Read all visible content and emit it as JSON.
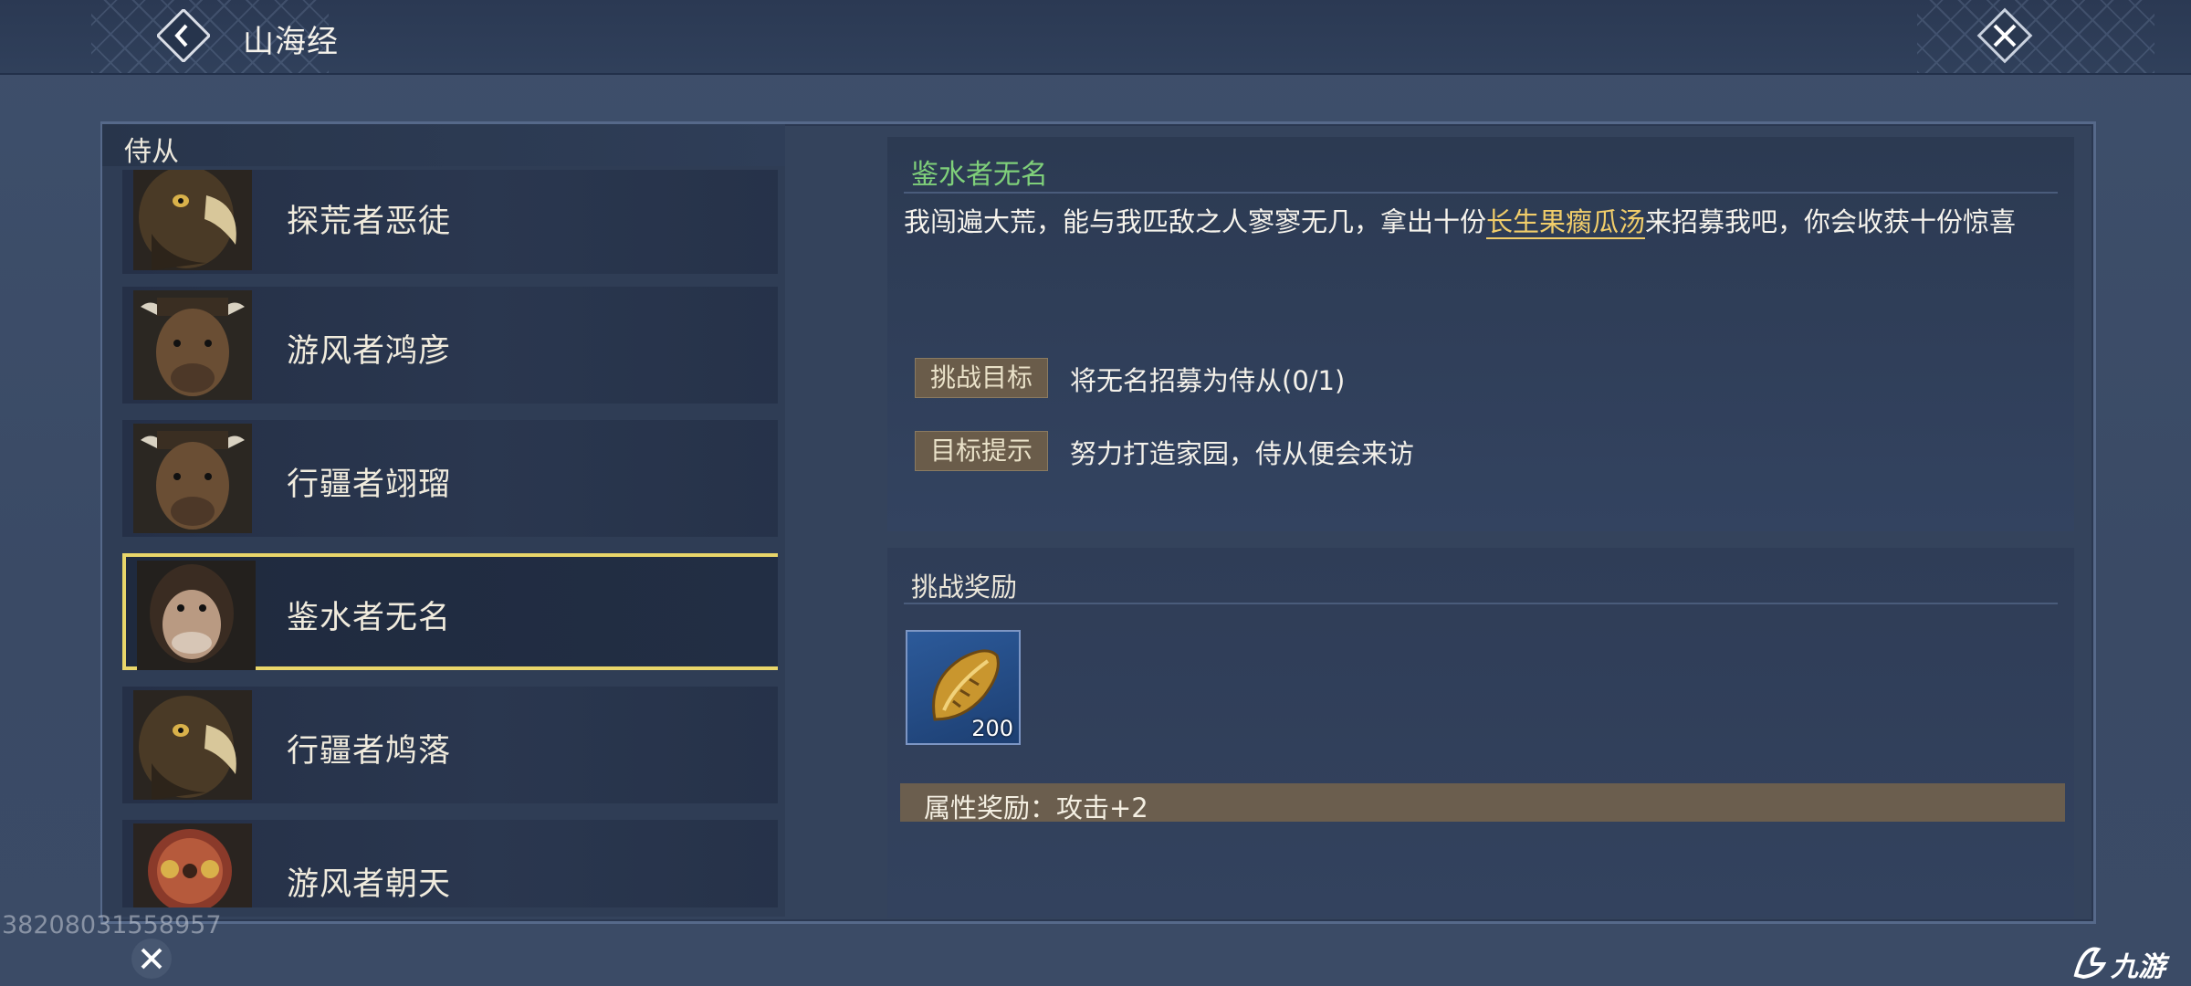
{
  "window": {
    "title": "山海经"
  },
  "left": {
    "header": "侍从",
    "items": [
      {
        "name": "探荒者恶徒",
        "portrait": "eagle-portrait",
        "selected": false
      },
      {
        "name": "游风者鸿彦",
        "portrait": "bull-portrait",
        "selected": false
      },
      {
        "name": "行疆者翊瑠",
        "portrait": "bull-portrait",
        "selected": false
      },
      {
        "name": "鉴水者无名",
        "portrait": "ape-portrait",
        "selected": true
      },
      {
        "name": "行疆者鸠落",
        "portrait": "eagle-portrait",
        "selected": false
      },
      {
        "name": "游风者朝天",
        "portrait": "ornate-mask-portrait",
        "selected": false
      }
    ]
  },
  "detail": {
    "name": "鉴水者无名",
    "desc_part1": "我闯遍大荒，能与我匹敌之人寥寥无几，拿出十份",
    "desc_highlight": "长生果瘸瓜汤",
    "desc_part2": "来招募我吧，你会收获十份惊喜",
    "goal_tag": "挑战目标",
    "goal_text": "将无名招募为侍从(0/1)",
    "hint_tag": "目标提示",
    "hint_text": "努力打造家园，侍从便会来访"
  },
  "reward": {
    "title": "挑战奖励",
    "item_icon": "seed-pod-icon",
    "item_count": "200",
    "attribute_text": "属性奖励：攻击+2"
  },
  "footer": {
    "id_text": "38208031558957",
    "logo_text": "九游"
  },
  "colors": {
    "selected_border": "#e9d66a",
    "name_green": "#7fd07a",
    "highlight_gold": "#f1cd6a"
  }
}
